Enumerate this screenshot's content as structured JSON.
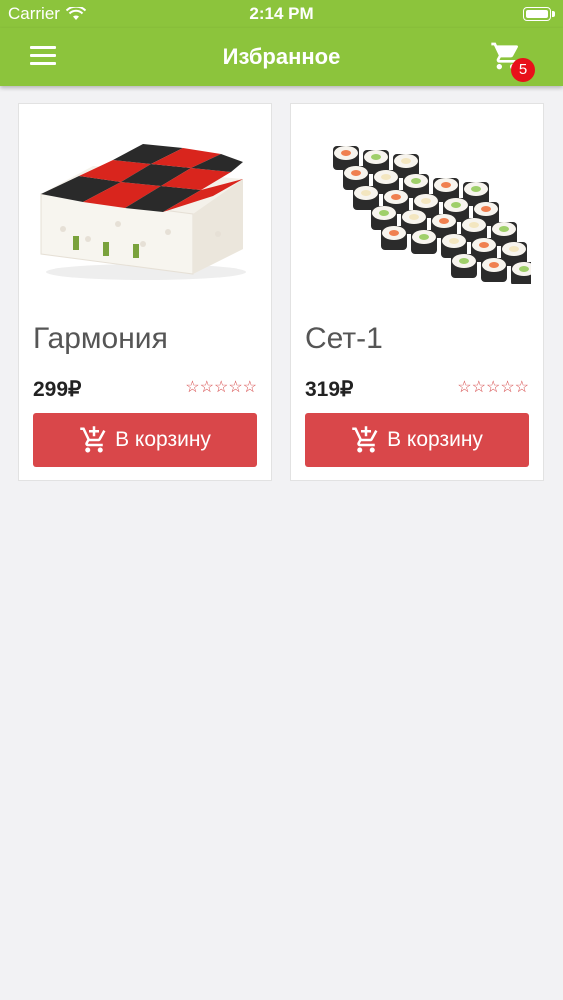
{
  "status_bar": {
    "carrier": "Carrier",
    "time": "2:14 PM"
  },
  "header": {
    "title": "Избранное",
    "cart_count": "5"
  },
  "products": [
    {
      "name": "Гармония",
      "price": "299₽",
      "stars": "☆☆☆☆☆",
      "button_label": "В корзину",
      "rating": 0
    },
    {
      "name": "Сет-1",
      "price": "319₽",
      "stars": "☆☆☆☆☆",
      "button_label": "В корзину",
      "rating": 0
    }
  ],
  "colors": {
    "accent": "#8cc43c",
    "button": "#d9474a",
    "badge": "#e8101a"
  },
  "icons": [
    "menu-icon",
    "cart-icon",
    "wifi-icon",
    "battery-icon",
    "add-to-cart-icon",
    "star-icon"
  ]
}
